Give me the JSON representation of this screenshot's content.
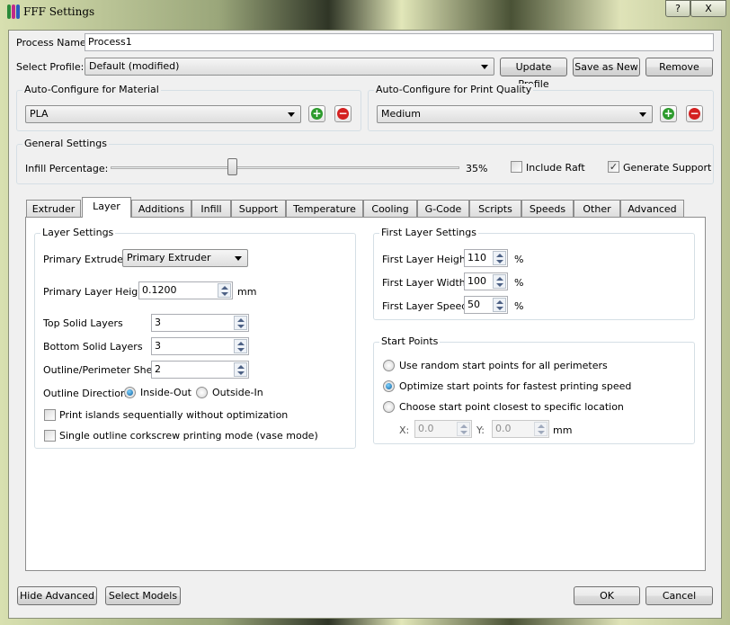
{
  "window": {
    "title": "FFF Settings",
    "help_label": "?",
    "close_label": "X"
  },
  "process": {
    "name_label": "Process Name:",
    "name_value": "Process1",
    "profile_label": "Select Profile:",
    "profile_value": "Default (modified)",
    "update_profile": "Update Profile",
    "save_as_new": "Save as New",
    "remove": "Remove"
  },
  "material": {
    "title": "Auto-Configure for Material",
    "value": "PLA"
  },
  "quality": {
    "title": "Auto-Configure for Print Quality",
    "value": "Medium"
  },
  "general": {
    "title": "General Settings",
    "infill_label": "Infill Percentage:",
    "infill_value": 35,
    "infill_text": "35%",
    "raft_label": "Include Raft",
    "raft_checked": false,
    "support_label": "Generate Support",
    "support_checked": true
  },
  "tabs": [
    "Extruder",
    "Layer",
    "Additions",
    "Infill",
    "Support",
    "Temperature",
    "Cooling",
    "G-Code",
    "Scripts",
    "Speeds",
    "Other",
    "Advanced"
  ],
  "active_tab": "Layer",
  "layer": {
    "title": "Layer Settings",
    "primary_extruder_label": "Primary Extruder",
    "primary_extruder_value": "Primary Extruder",
    "layer_height_label": "Primary Layer Height",
    "layer_height_value": "0.1200",
    "layer_height_unit": "mm",
    "top_label": "Top Solid Layers",
    "top_value": "3",
    "bottom_label": "Bottom Solid Layers",
    "bottom_value": "3",
    "shells_label": "Outline/Perimeter Shells",
    "shells_value": "2",
    "direction_label": "Outline Direction:",
    "inside_out": "Inside-Out",
    "outside_in": "Outside-In",
    "islands_label": "Print islands sequentially without optimization",
    "vase_label": "Single outline corkscrew printing mode (vase mode)"
  },
  "first_layer": {
    "title": "First Layer Settings",
    "height_label": "First Layer Height",
    "height_value": "110",
    "width_label": "First Layer Width",
    "width_value": "100",
    "speed_label": "First Layer Speed",
    "speed_value": "50",
    "unit": "%"
  },
  "start_points": {
    "title": "Start Points",
    "random": "Use random start points for all perimeters",
    "optimize": "Optimize start points for fastest printing speed",
    "closest": "Choose start point closest to specific location",
    "x_label": "X:",
    "x_value": "0.0",
    "y_label": "Y:",
    "y_value": "0.0",
    "unit": "mm"
  },
  "footer": {
    "hide_advanced": "Hide Advanced",
    "select_models": "Select Models",
    "ok": "OK",
    "cancel": "Cancel"
  }
}
